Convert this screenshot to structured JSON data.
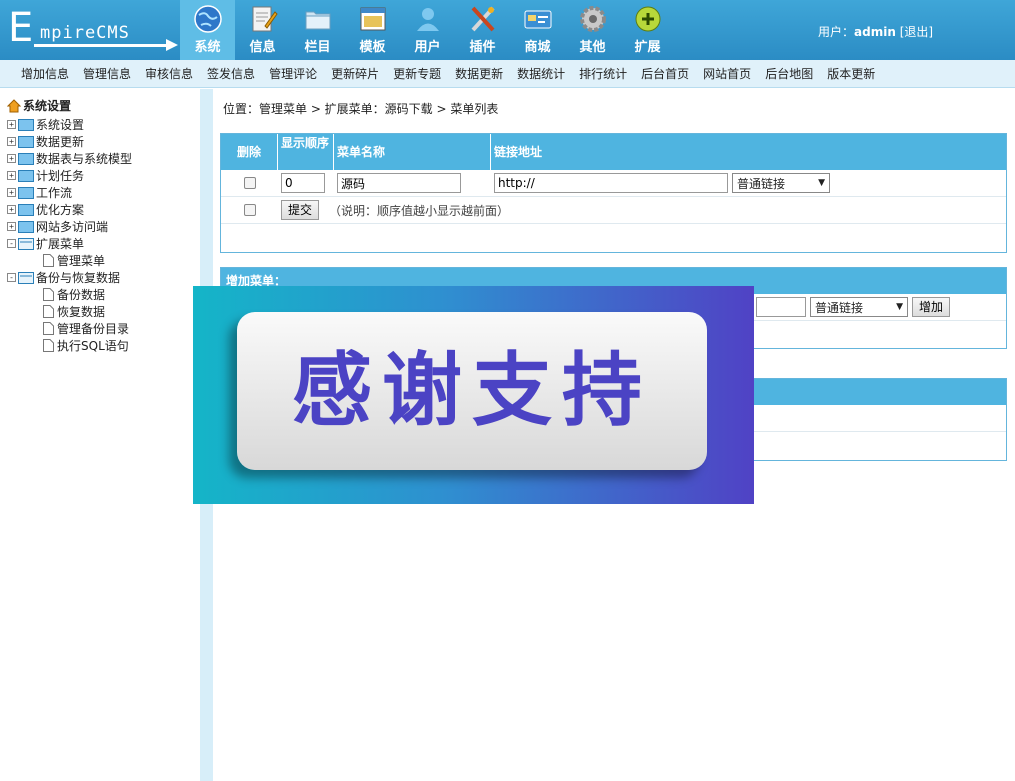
{
  "logo": {
    "big": "E",
    "rest": "mpireCMS"
  },
  "mainnav": [
    {
      "label": "系统",
      "icon": "globe-icon"
    },
    {
      "label": "信息",
      "icon": "document-pen-icon"
    },
    {
      "label": "栏目",
      "icon": "folder-icon"
    },
    {
      "label": "模板",
      "icon": "window-icon"
    },
    {
      "label": "用户",
      "icon": "user-icon"
    },
    {
      "label": "插件",
      "icon": "tools-icon"
    },
    {
      "label": "商城",
      "icon": "card-icon"
    },
    {
      "label": "其他",
      "icon": "gear-icon"
    },
    {
      "label": "扩展",
      "icon": "plus-circle-icon"
    }
  ],
  "user": {
    "prefix": "用户：",
    "name": "admin",
    "logout": "[退出]"
  },
  "subnav": [
    "增加信息",
    "管理信息",
    "审核信息",
    "签发信息",
    "管理评论",
    "更新碎片",
    "更新专题",
    "数据更新",
    "数据统计",
    "排行统计",
    "后台首页",
    "网站首页",
    "后台地图",
    "版本更新"
  ],
  "sidebar": {
    "root": "系统设置",
    "nodes": [
      {
        "label": "系统设置",
        "expander": "+"
      },
      {
        "label": "数据更新",
        "expander": "+"
      },
      {
        "label": "数据表与系统模型",
        "expander": "+"
      },
      {
        "label": "计划任务",
        "expander": "+"
      },
      {
        "label": "工作流",
        "expander": "+"
      },
      {
        "label": "优化方案",
        "expander": "+"
      },
      {
        "label": "网站多访问端",
        "expander": "+"
      },
      {
        "label": "扩展菜单",
        "expander": "-"
      },
      {
        "label": "管理菜单",
        "child": true
      },
      {
        "label": "备份与恢复数据",
        "expander": "-"
      },
      {
        "label": "备份数据",
        "child": true
      },
      {
        "label": "恢复数据",
        "child": true
      },
      {
        "label": "管理备份目录",
        "child": true
      },
      {
        "label": "执行SQL语句",
        "child": true
      }
    ]
  },
  "breadcrumb": "位置：管理菜单 > 扩展菜单：源码下载 > 菜单列表",
  "table": {
    "headers": {
      "delete": "删除",
      "order": "显示顺序",
      "name": "菜单名称",
      "link": "链接地址"
    },
    "row": {
      "order": "0",
      "name": "源码",
      "link": "http://",
      "linktype": "普通链接"
    },
    "submit": "提交",
    "note": "（说明：顺序值越小显示越前面）"
  },
  "addpanel": {
    "title": "增加菜单：",
    "linktype": "普通链接",
    "add": "增加"
  },
  "overlay": {
    "text": "感谢支持"
  },
  "colors": {
    "topbar": "#2b8cc4",
    "header": "#4fb4e0",
    "subnav": "#e0f1fa"
  }
}
